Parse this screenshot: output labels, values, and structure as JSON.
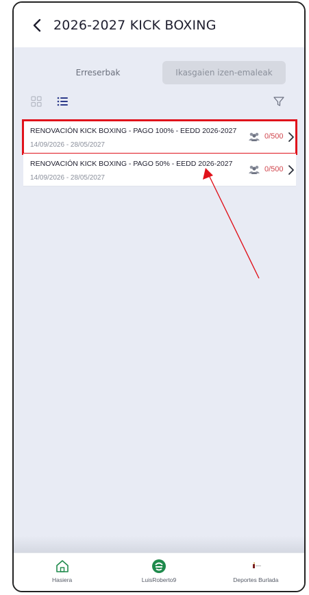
{
  "header": {
    "title": "2026-2027 KICK BOXING",
    "back_icon": "chevron-left-icon"
  },
  "tabs": {
    "reservations_label": "Erreserbak",
    "registrations_label": "Ikasgaien izen-emaleak"
  },
  "toolbar": {
    "grid_icon": "grid-view-icon",
    "list_icon": "list-view-icon",
    "filter_icon": "filter-icon"
  },
  "items": [
    {
      "title": "RENOVACIÓN KICK BOXING - PAGO 100% - EEDD 2026-2027",
      "dates": "14/09/2026 - 28/05/2027",
      "count": "0/500",
      "highlighted": true
    },
    {
      "title": "RENOVACIÓN KICK BOXING - PAGO 50% - EEDD 2026-2027",
      "dates": "14/09/2026 - 28/05/2027",
      "count": "0/500",
      "highlighted": false
    }
  ],
  "bottom_nav": [
    {
      "label": "Hasiera",
      "icon": "home-icon"
    },
    {
      "label": "LuisRoberto9",
      "icon": "profile-logo-icon"
    },
    {
      "label": "Deportes Burlada",
      "icon": "club-logo-icon"
    }
  ],
  "colors": {
    "accent": "#1f8a4c",
    "highlight": "#e0121b",
    "count_text": "#d0454c",
    "background": "#e8ebf4"
  }
}
